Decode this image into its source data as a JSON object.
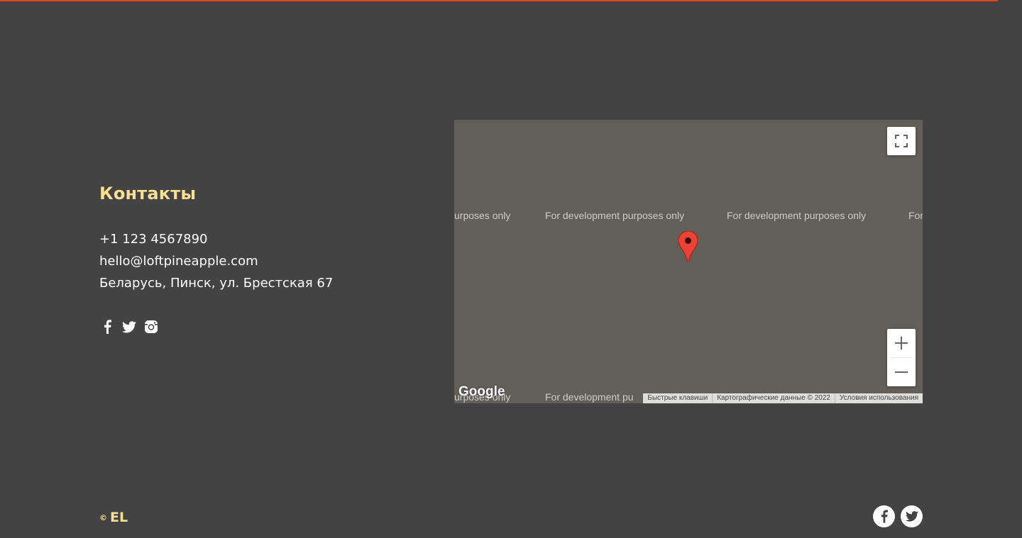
{
  "contacts": {
    "title": "Контакты",
    "phone": "+1 123 4567890",
    "email": "hello@loftpineapple.com",
    "address": "Беларусь, Пинск, ул. Брестская 67",
    "social_icons": [
      "facebook-icon",
      "twitter-icon",
      "instagram-icon"
    ]
  },
  "map": {
    "watermark": "For development purposes only",
    "watermark_partial_left": "urposes only",
    "watermark_partial_right": "For",
    "watermark_bottom_left": "urposes only",
    "watermark_bottom_mid": "For development pu",
    "google_logo": "Google",
    "attribution": {
      "shortcuts": "Быстрые клавиши",
      "map_data": "Картографические данные © 2022",
      "terms": "Условия использования"
    },
    "controls": [
      "fullscreen-icon",
      "zoom-in-icon",
      "zoom-out-icon"
    ],
    "marker_color": "#ea4335"
  },
  "footer": {
    "copyright_symbol": "©",
    "copyright_text": "EL",
    "social_icons": [
      "facebook-icon",
      "twitter-icon"
    ]
  },
  "colors": {
    "background": "#434343",
    "accent": "#f9df92",
    "top_line": "#e2461d",
    "map_bg": "#625f58"
  }
}
